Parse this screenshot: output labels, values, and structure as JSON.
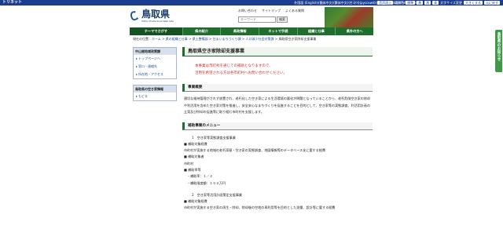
{
  "topbar": {
    "brand": "トリネット",
    "languages": "外国語 (English)(簡体中文)(繁体中文)(한국어)(русский)(yasashii日本語)(Tiếng Việt)",
    "tools": [
      "音声読上",
      "背景色",
      "標準",
      "黄",
      "黒",
      "青"
    ],
    "fontsize_label": "文字サイズ変更",
    "fontsize_buttons": [
      "大きくする",
      "元に戻す"
    ]
  },
  "header": {
    "logo_title": "鳥取県",
    "logo_sub": "Tottori Prefectural Web Site",
    "links": [
      "お問い合わせ",
      "サイトマップ",
      "よくある質問"
    ],
    "search_placeholder": "キーワード",
    "search_button": "検索"
  },
  "nav": {
    "items": [
      "テーマでさがす",
      "県の紹介",
      "県政情報",
      "ネットで手続",
      "組織と仕事",
      "県外の方へ"
    ]
  },
  "breadcrumb": [
    "現在の位置",
    "ホーム",
    "県の組織と仕事",
    "県土整備部",
    "住まいまちづくり課",
    "人口減少社会対策課",
    "鳥取県空き家除却支援事業"
  ],
  "sidebar": {
    "box1_title": "中山間地域政策課",
    "box1_links": [
      "トップページへ",
      "窓口・連絡先",
      "所在地・アクセス"
    ],
    "box2_title": "鳥取県の空き家情報",
    "box2_links": [
      "もどる"
    ]
  },
  "main": {
    "title": "鳥取県空き家除却支援事業",
    "notice_lines": [
      "本事業は市町村を通じての補助となりますので、",
      "活用を希望される方は各市町村へお問い合わせください。"
    ],
    "section1_heading": "事業概要",
    "overview": "適切な維持管理がされず放置され、老朽化した空き家による生活環境の悪化が問題となっていることから、老朽危険空き家の除却や利活用を含めた空き家対策を推進し、安全安心なまちづくりを促進することを目的として、空き家等の実態調査、利活用計画の立案及び除却の促進等に取り組む市町村を支援します。",
    "section2_heading": "補助事業のメニュー",
    "menu_items": [
      "1　空き家等実態調査支援事業",
      "■ 補助対象経費",
      "市町村が実施する地域の老朽家屋・空き家の実態調査、地図情報等のデータベース化に要する経費",
      "■ 補助対象者",
      "市町村",
      "■ 補助率等",
      "・補助率：１／２",
      "・補助限度額：１００万円",
      "",
      "2　空き家等活用計画策定支援事業",
      "■ 補助対象経費",
      "市町村が実施する空き家の再生・除却、除却後の空地の再利用等を目的とした測量、設計等に要する経費"
    ]
  },
  "float_tab": "鳥取県のお知らせ",
  "colors": {
    "topbar": "#1a3d8f",
    "nav": "#1f6e2e",
    "notice": "#d32f2f",
    "link": "#1a4ea0"
  }
}
